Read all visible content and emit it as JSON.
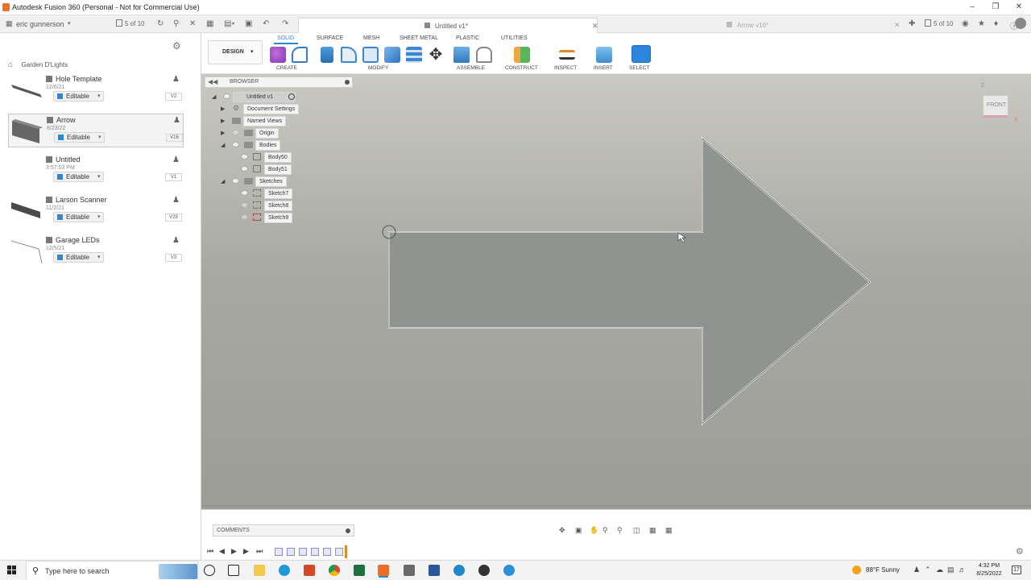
{
  "window": {
    "title": "Autodesk Fusion 360 (Personal - Not for Commercial Use)",
    "colors": {
      "brand_orange": "#e8702a",
      "accent_blue": "#2f86d1"
    }
  },
  "data_panel": {
    "user": "eric gunnerson",
    "count": "5 of 10",
    "breadcrumb": "Garden D'Lights",
    "items": [
      {
        "name": "Hole Template",
        "date": "12/6/21",
        "status": "Editable",
        "version": "V2"
      },
      {
        "name": "Arrow",
        "date": "8/23/22",
        "status": "Editable",
        "version": "V16"
      },
      {
        "name": "Untitled",
        "date": "3:57:03 PM",
        "status": "Editable",
        "version": "V1"
      },
      {
        "name": "Larson Scanner",
        "date": "11/2/21",
        "status": "Editable",
        "version": "V29"
      },
      {
        "name": "Garage LEDs",
        "date": "12/5/21",
        "status": "Editable",
        "version": "V3"
      }
    ]
  },
  "tabs": {
    "active": "Untitled v1*",
    "inactive": "Arrow v16*",
    "count": "5 of 10"
  },
  "toolbar": {
    "workspace": "DESIGN",
    "tabs": [
      "SOLID",
      "SURFACE",
      "MESH",
      "SHEET METAL",
      "PLASTIC",
      "UTILITIES"
    ],
    "groups": [
      "CREATE",
      "MODIFY",
      "ASSEMBLE",
      "CONSTRUCT",
      "INSPECT",
      "INSERT",
      "SELECT"
    ]
  },
  "browser": {
    "title": "BROWSER",
    "root": "Untitled v1",
    "nodes": [
      "Document Settings",
      "Named Views",
      "Origin",
      "Bodies",
      "Body50",
      "Body51",
      "Sketches",
      "Sketch7",
      "Sketch8",
      "Sketch9"
    ]
  },
  "viewcube": {
    "face": "FRONT",
    "axis_z": "Z",
    "axis_x": "X"
  },
  "comments": {
    "label": "COMMENTS"
  },
  "taskbar": {
    "search_placeholder": "Type here to search",
    "weather": "88°F  Sunny",
    "time": "4:32 PM",
    "date": "8/25/2022",
    "notifications": "17"
  }
}
